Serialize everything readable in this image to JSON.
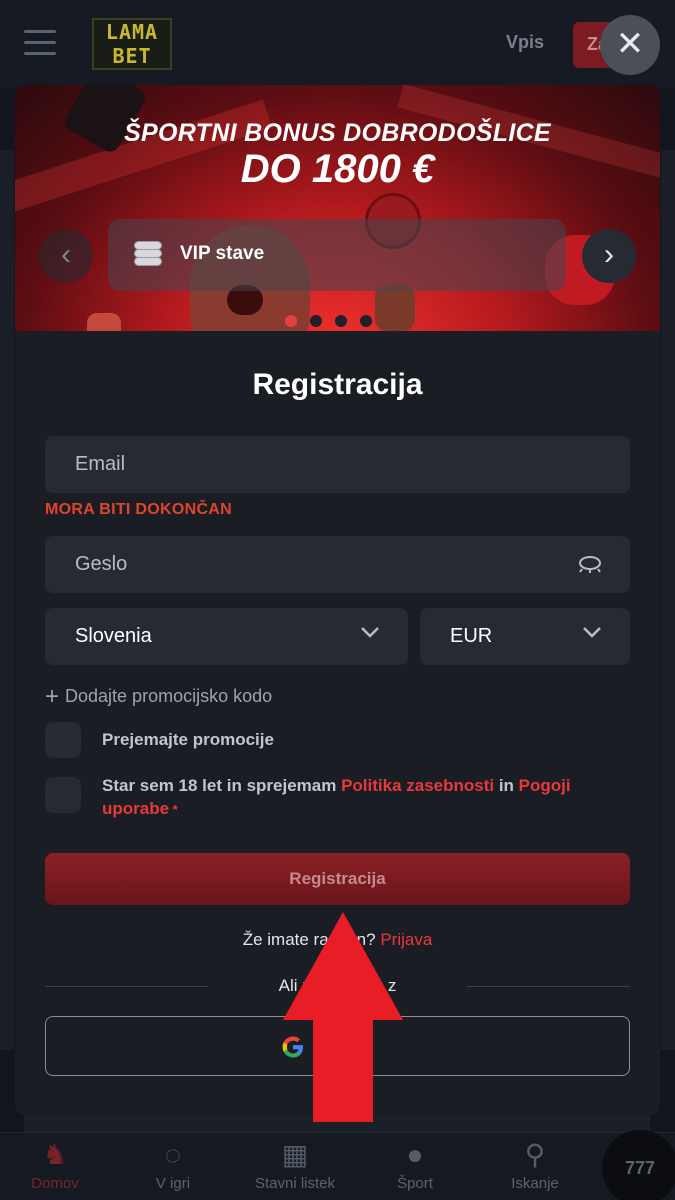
{
  "header": {
    "logo_line1": "LAMA",
    "logo_line2": "BET",
    "login_label": "Vpis",
    "signup_label": "Za"
  },
  "modal": {
    "close_icon": "close-icon",
    "banner": {
      "title": "ŠPORTNI BONUS DOBRODOŠLICE",
      "amount": "DO 1800 €",
      "card_label": "VIP stave",
      "card_icon": "coins-icon",
      "dots_count": 4,
      "active_dot": 0
    },
    "form": {
      "title": "Registracija",
      "email_placeholder": "Email",
      "email_error": "MORA BITI DOKONČAN",
      "password_placeholder": "Geslo",
      "country_value": "Slovenia",
      "currency_value": "EUR",
      "promo_label": "Dodajte promocijsko kodo",
      "checkbox1_label": "Prejemajte promocije",
      "checkbox2_text_start": "Star sem 18 let in sprejemam ",
      "privacy_link": "Politika zasebnosti",
      "checkbox2_text_mid": " in ",
      "terms_link": "Pogoji uporabe",
      "required_mark": " *",
      "submit_label": "Registracija",
      "have_account_text": "Že imate ra",
      "have_account_tail": "n?",
      "login_link": "Prijava",
      "or_text_start": "Ali pa",
      "or_text_end": "ite z",
      "google_label": "LE"
    }
  },
  "bottom_nav": {
    "items": [
      {
        "label": "Domov",
        "icon": "llama-icon",
        "active": true
      },
      {
        "label": "V igri",
        "icon": "live-icon",
        "active": false
      },
      {
        "label": "Stavni listek",
        "icon": "ticket-icon",
        "active": false
      },
      {
        "label": "Šport",
        "icon": "basketball-icon",
        "active": false
      },
      {
        "label": "Iskanje",
        "icon": "search-icon",
        "active": false
      }
    ],
    "chat_label": "777"
  },
  "colors": {
    "accent": "#e8383a",
    "error": "#e2442a",
    "background": "#12151c",
    "modal": "#1a1d24",
    "field": "#262a33"
  }
}
